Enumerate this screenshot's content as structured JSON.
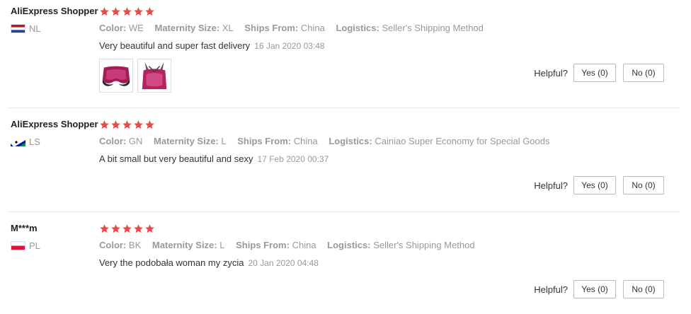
{
  "reviews": [
    {
      "name": "AliExpress Shopper",
      "rating": 5,
      "country": "NL",
      "flag": "nl",
      "attrs": [
        {
          "key": "Color:",
          "value": "WE"
        },
        {
          "key": "Maternity Size:",
          "value": "XL"
        },
        {
          "key": "Ships From:",
          "value": "China"
        },
        {
          "key": "Logistics:",
          "value": "Seller's Shipping Method"
        }
      ],
      "comment": "Very beautiful and super fast delivery",
      "date": "16 Jan 2020 03:48",
      "photos": 2,
      "helpful_label": "Helpful?",
      "yes_label": "Yes (0)",
      "no_label": "No (0)"
    },
    {
      "name": "AliExpress Shopper",
      "rating": 5,
      "country": "LS",
      "flag": "ls",
      "attrs": [
        {
          "key": "Color:",
          "value": "GN"
        },
        {
          "key": "Maternity Size:",
          "value": "L"
        },
        {
          "key": "Ships From:",
          "value": "China"
        },
        {
          "key": "Logistics:",
          "value": "Cainiao Super Economy for Special Goods"
        }
      ],
      "comment": "A bit small but very beautiful and sexy",
      "date": "17 Feb 2020 00:37",
      "photos": 0,
      "helpful_label": "Helpful?",
      "yes_label": "Yes (0)",
      "no_label": "No (0)"
    },
    {
      "name": "M***m",
      "rating": 5,
      "country": "PL",
      "flag": "pl",
      "attrs": [
        {
          "key": "Color:",
          "value": "BK"
        },
        {
          "key": "Maternity Size:",
          "value": "L"
        },
        {
          "key": "Ships From:",
          "value": "China"
        },
        {
          "key": "Logistics:",
          "value": "Seller's Shipping Method"
        }
      ],
      "comment": "Very the podobała woman my zycia",
      "date": "20 Jan 2020 04:48",
      "photos": 0,
      "helpful_label": "Helpful?",
      "yes_label": "Yes (0)",
      "no_label": "No (0)"
    }
  ],
  "colors": {
    "star": "#e84a4a",
    "muted": "#999999",
    "border": "#e8e8e8"
  }
}
